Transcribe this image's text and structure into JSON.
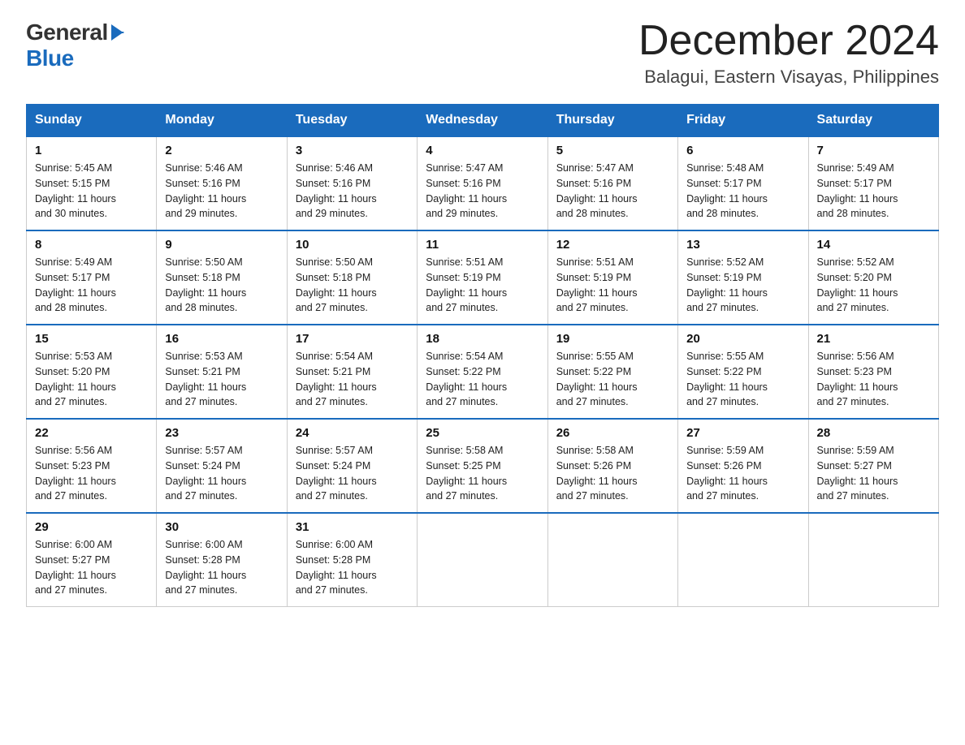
{
  "logo": {
    "general": "General",
    "blue": "Blue"
  },
  "title": {
    "month_year": "December 2024",
    "location": "Balagui, Eastern Visayas, Philippines"
  },
  "days_of_week": [
    "Sunday",
    "Monday",
    "Tuesday",
    "Wednesday",
    "Thursday",
    "Friday",
    "Saturday"
  ],
  "weeks": [
    [
      {
        "day": "1",
        "sunrise": "5:45 AM",
        "sunset": "5:15 PM",
        "daylight": "11 hours and 30 minutes."
      },
      {
        "day": "2",
        "sunrise": "5:46 AM",
        "sunset": "5:16 PM",
        "daylight": "11 hours and 29 minutes."
      },
      {
        "day": "3",
        "sunrise": "5:46 AM",
        "sunset": "5:16 PM",
        "daylight": "11 hours and 29 minutes."
      },
      {
        "day": "4",
        "sunrise": "5:47 AM",
        "sunset": "5:16 PM",
        "daylight": "11 hours and 29 minutes."
      },
      {
        "day": "5",
        "sunrise": "5:47 AM",
        "sunset": "5:16 PM",
        "daylight": "11 hours and 28 minutes."
      },
      {
        "day": "6",
        "sunrise": "5:48 AM",
        "sunset": "5:17 PM",
        "daylight": "11 hours and 28 minutes."
      },
      {
        "day": "7",
        "sunrise": "5:49 AM",
        "sunset": "5:17 PM",
        "daylight": "11 hours and 28 minutes."
      }
    ],
    [
      {
        "day": "8",
        "sunrise": "5:49 AM",
        "sunset": "5:17 PM",
        "daylight": "11 hours and 28 minutes."
      },
      {
        "day": "9",
        "sunrise": "5:50 AM",
        "sunset": "5:18 PM",
        "daylight": "11 hours and 28 minutes."
      },
      {
        "day": "10",
        "sunrise": "5:50 AM",
        "sunset": "5:18 PM",
        "daylight": "11 hours and 27 minutes."
      },
      {
        "day": "11",
        "sunrise": "5:51 AM",
        "sunset": "5:19 PM",
        "daylight": "11 hours and 27 minutes."
      },
      {
        "day": "12",
        "sunrise": "5:51 AM",
        "sunset": "5:19 PM",
        "daylight": "11 hours and 27 minutes."
      },
      {
        "day": "13",
        "sunrise": "5:52 AM",
        "sunset": "5:19 PM",
        "daylight": "11 hours and 27 minutes."
      },
      {
        "day": "14",
        "sunrise": "5:52 AM",
        "sunset": "5:20 PM",
        "daylight": "11 hours and 27 minutes."
      }
    ],
    [
      {
        "day": "15",
        "sunrise": "5:53 AM",
        "sunset": "5:20 PM",
        "daylight": "11 hours and 27 minutes."
      },
      {
        "day": "16",
        "sunrise": "5:53 AM",
        "sunset": "5:21 PM",
        "daylight": "11 hours and 27 minutes."
      },
      {
        "day": "17",
        "sunrise": "5:54 AM",
        "sunset": "5:21 PM",
        "daylight": "11 hours and 27 minutes."
      },
      {
        "day": "18",
        "sunrise": "5:54 AM",
        "sunset": "5:22 PM",
        "daylight": "11 hours and 27 minutes."
      },
      {
        "day": "19",
        "sunrise": "5:55 AM",
        "sunset": "5:22 PM",
        "daylight": "11 hours and 27 minutes."
      },
      {
        "day": "20",
        "sunrise": "5:55 AM",
        "sunset": "5:22 PM",
        "daylight": "11 hours and 27 minutes."
      },
      {
        "day": "21",
        "sunrise": "5:56 AM",
        "sunset": "5:23 PM",
        "daylight": "11 hours and 27 minutes."
      }
    ],
    [
      {
        "day": "22",
        "sunrise": "5:56 AM",
        "sunset": "5:23 PM",
        "daylight": "11 hours and 27 minutes."
      },
      {
        "day": "23",
        "sunrise": "5:57 AM",
        "sunset": "5:24 PM",
        "daylight": "11 hours and 27 minutes."
      },
      {
        "day": "24",
        "sunrise": "5:57 AM",
        "sunset": "5:24 PM",
        "daylight": "11 hours and 27 minutes."
      },
      {
        "day": "25",
        "sunrise": "5:58 AM",
        "sunset": "5:25 PM",
        "daylight": "11 hours and 27 minutes."
      },
      {
        "day": "26",
        "sunrise": "5:58 AM",
        "sunset": "5:26 PM",
        "daylight": "11 hours and 27 minutes."
      },
      {
        "day": "27",
        "sunrise": "5:59 AM",
        "sunset": "5:26 PM",
        "daylight": "11 hours and 27 minutes."
      },
      {
        "day": "28",
        "sunrise": "5:59 AM",
        "sunset": "5:27 PM",
        "daylight": "11 hours and 27 minutes."
      }
    ],
    [
      {
        "day": "29",
        "sunrise": "6:00 AM",
        "sunset": "5:27 PM",
        "daylight": "11 hours and 27 minutes."
      },
      {
        "day": "30",
        "sunrise": "6:00 AM",
        "sunset": "5:28 PM",
        "daylight": "11 hours and 27 minutes."
      },
      {
        "day": "31",
        "sunrise": "6:00 AM",
        "sunset": "5:28 PM",
        "daylight": "11 hours and 27 minutes."
      },
      null,
      null,
      null,
      null
    ]
  ],
  "labels": {
    "sunrise": "Sunrise:",
    "sunset": "Sunset:",
    "daylight": "Daylight:"
  }
}
